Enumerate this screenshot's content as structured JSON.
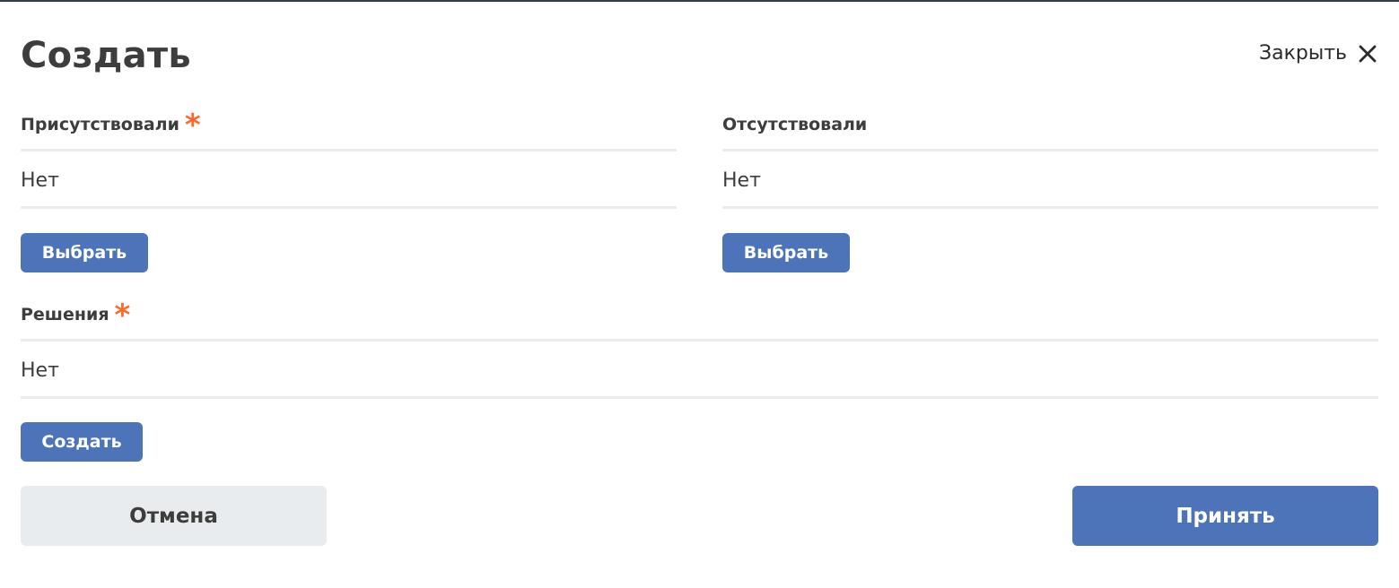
{
  "modal": {
    "title": "Создать",
    "close_label": "Закрыть"
  },
  "fields": {
    "present": {
      "label": "Присутствовали",
      "required_mark": "*",
      "value": "Нет",
      "button_label": "Выбрать"
    },
    "absent": {
      "label": "Отсутствовали",
      "value": "Нет",
      "button_label": "Выбрать"
    },
    "decisions": {
      "label": "Решения",
      "required_mark": "*",
      "value": "Нет",
      "button_label": "Создать"
    }
  },
  "footer": {
    "cancel_label": "Отмена",
    "accept_label": "Принять"
  },
  "colors": {
    "primary": "#4d74b8",
    "required": "#ff6a2b",
    "secondary_button": "#e8ecee",
    "text": "#3d3d3d"
  },
  "icons": {
    "close": "close-icon"
  }
}
